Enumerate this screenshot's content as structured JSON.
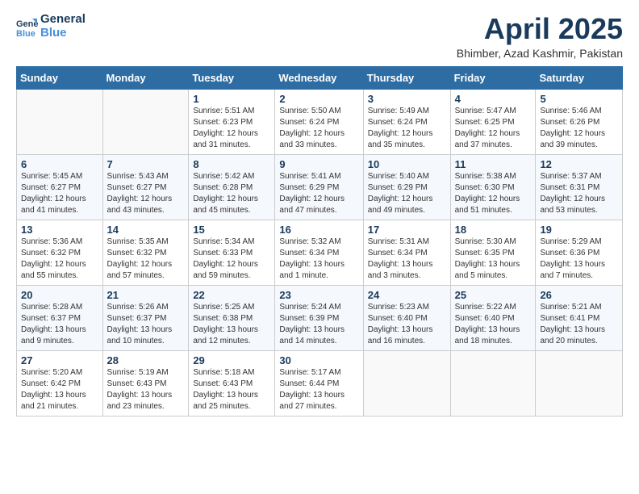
{
  "header": {
    "logo_line1": "General",
    "logo_line2": "Blue",
    "month_title": "April 2025",
    "location": "Bhimber, Azad Kashmir, Pakistan"
  },
  "days_of_week": [
    "Sunday",
    "Monday",
    "Tuesday",
    "Wednesday",
    "Thursday",
    "Friday",
    "Saturday"
  ],
  "weeks": [
    [
      {
        "day": "",
        "info": ""
      },
      {
        "day": "",
        "info": ""
      },
      {
        "day": "1",
        "info": "Sunrise: 5:51 AM\nSunset: 6:23 PM\nDaylight: 12 hours and 31 minutes."
      },
      {
        "day": "2",
        "info": "Sunrise: 5:50 AM\nSunset: 6:24 PM\nDaylight: 12 hours and 33 minutes."
      },
      {
        "day": "3",
        "info": "Sunrise: 5:49 AM\nSunset: 6:24 PM\nDaylight: 12 hours and 35 minutes."
      },
      {
        "day": "4",
        "info": "Sunrise: 5:47 AM\nSunset: 6:25 PM\nDaylight: 12 hours and 37 minutes."
      },
      {
        "day": "5",
        "info": "Sunrise: 5:46 AM\nSunset: 6:26 PM\nDaylight: 12 hours and 39 minutes."
      }
    ],
    [
      {
        "day": "6",
        "info": "Sunrise: 5:45 AM\nSunset: 6:27 PM\nDaylight: 12 hours and 41 minutes."
      },
      {
        "day": "7",
        "info": "Sunrise: 5:43 AM\nSunset: 6:27 PM\nDaylight: 12 hours and 43 minutes."
      },
      {
        "day": "8",
        "info": "Sunrise: 5:42 AM\nSunset: 6:28 PM\nDaylight: 12 hours and 45 minutes."
      },
      {
        "day": "9",
        "info": "Sunrise: 5:41 AM\nSunset: 6:29 PM\nDaylight: 12 hours and 47 minutes."
      },
      {
        "day": "10",
        "info": "Sunrise: 5:40 AM\nSunset: 6:29 PM\nDaylight: 12 hours and 49 minutes."
      },
      {
        "day": "11",
        "info": "Sunrise: 5:38 AM\nSunset: 6:30 PM\nDaylight: 12 hours and 51 minutes."
      },
      {
        "day": "12",
        "info": "Sunrise: 5:37 AM\nSunset: 6:31 PM\nDaylight: 12 hours and 53 minutes."
      }
    ],
    [
      {
        "day": "13",
        "info": "Sunrise: 5:36 AM\nSunset: 6:32 PM\nDaylight: 12 hours and 55 minutes."
      },
      {
        "day": "14",
        "info": "Sunrise: 5:35 AM\nSunset: 6:32 PM\nDaylight: 12 hours and 57 minutes."
      },
      {
        "day": "15",
        "info": "Sunrise: 5:34 AM\nSunset: 6:33 PM\nDaylight: 12 hours and 59 minutes."
      },
      {
        "day": "16",
        "info": "Sunrise: 5:32 AM\nSunset: 6:34 PM\nDaylight: 13 hours and 1 minute."
      },
      {
        "day": "17",
        "info": "Sunrise: 5:31 AM\nSunset: 6:34 PM\nDaylight: 13 hours and 3 minutes."
      },
      {
        "day": "18",
        "info": "Sunrise: 5:30 AM\nSunset: 6:35 PM\nDaylight: 13 hours and 5 minutes."
      },
      {
        "day": "19",
        "info": "Sunrise: 5:29 AM\nSunset: 6:36 PM\nDaylight: 13 hours and 7 minutes."
      }
    ],
    [
      {
        "day": "20",
        "info": "Sunrise: 5:28 AM\nSunset: 6:37 PM\nDaylight: 13 hours and 9 minutes."
      },
      {
        "day": "21",
        "info": "Sunrise: 5:26 AM\nSunset: 6:37 PM\nDaylight: 13 hours and 10 minutes."
      },
      {
        "day": "22",
        "info": "Sunrise: 5:25 AM\nSunset: 6:38 PM\nDaylight: 13 hours and 12 minutes."
      },
      {
        "day": "23",
        "info": "Sunrise: 5:24 AM\nSunset: 6:39 PM\nDaylight: 13 hours and 14 minutes."
      },
      {
        "day": "24",
        "info": "Sunrise: 5:23 AM\nSunset: 6:40 PM\nDaylight: 13 hours and 16 minutes."
      },
      {
        "day": "25",
        "info": "Sunrise: 5:22 AM\nSunset: 6:40 PM\nDaylight: 13 hours and 18 minutes."
      },
      {
        "day": "26",
        "info": "Sunrise: 5:21 AM\nSunset: 6:41 PM\nDaylight: 13 hours and 20 minutes."
      }
    ],
    [
      {
        "day": "27",
        "info": "Sunrise: 5:20 AM\nSunset: 6:42 PM\nDaylight: 13 hours and 21 minutes."
      },
      {
        "day": "28",
        "info": "Sunrise: 5:19 AM\nSunset: 6:43 PM\nDaylight: 13 hours and 23 minutes."
      },
      {
        "day": "29",
        "info": "Sunrise: 5:18 AM\nSunset: 6:43 PM\nDaylight: 13 hours and 25 minutes."
      },
      {
        "day": "30",
        "info": "Sunrise: 5:17 AM\nSunset: 6:44 PM\nDaylight: 13 hours and 27 minutes."
      },
      {
        "day": "",
        "info": ""
      },
      {
        "day": "",
        "info": ""
      },
      {
        "day": "",
        "info": ""
      }
    ]
  ]
}
